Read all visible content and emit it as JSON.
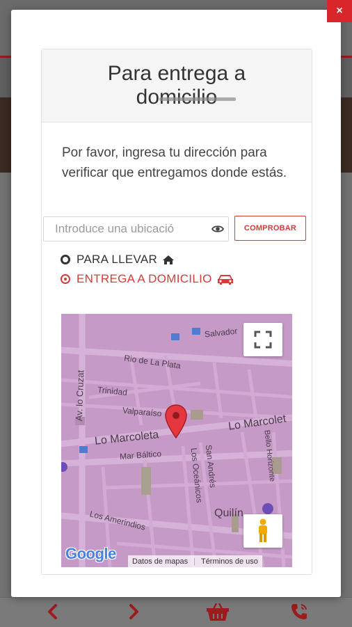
{
  "modal": {
    "close_label": "×",
    "title": "Para entrega a domicilio",
    "intro": "Por favor, ingresa tu dirección para verificar que entregamos donde estás.",
    "address_placeholder": "Introduce una ubicació",
    "check_button": "COMPROBAR",
    "options": [
      {
        "label": "PARA LLEVAR",
        "icon": "home-icon",
        "selected": false
      },
      {
        "label": "ENTREGA A DOMICILIO",
        "icon": "car-icon",
        "selected": true
      }
    ]
  },
  "map": {
    "streets": {
      "salvador": "Salvador",
      "rio_la_plata": "Rio de La Plata",
      "av_lo_cruzat": "Av. lo Cruzat",
      "trinidad": "Trinidad",
      "valparaiso": "Valparaíso",
      "lo_marcoleta_1": "Lo Marcoleta",
      "lo_marcoleta_2": "Lo Marcolet",
      "mar_baltico": "Mar Báltico",
      "los_oceanicos": "Los Oceánicos",
      "san_andres": "San Andrés",
      "bello_horizonte": "Bello Horizonte",
      "los_amerindios": "Los Amerindios",
      "quilin": "Quilín"
    },
    "logo": "Google",
    "attribution_data": "Datos de mapas",
    "attribution_terms": "Términos de uso"
  },
  "colors": {
    "accent": "#d43b3b",
    "close_bg": "#d9262b",
    "map_bg": "#c59ac6",
    "map_street": "#d7b2d8"
  }
}
